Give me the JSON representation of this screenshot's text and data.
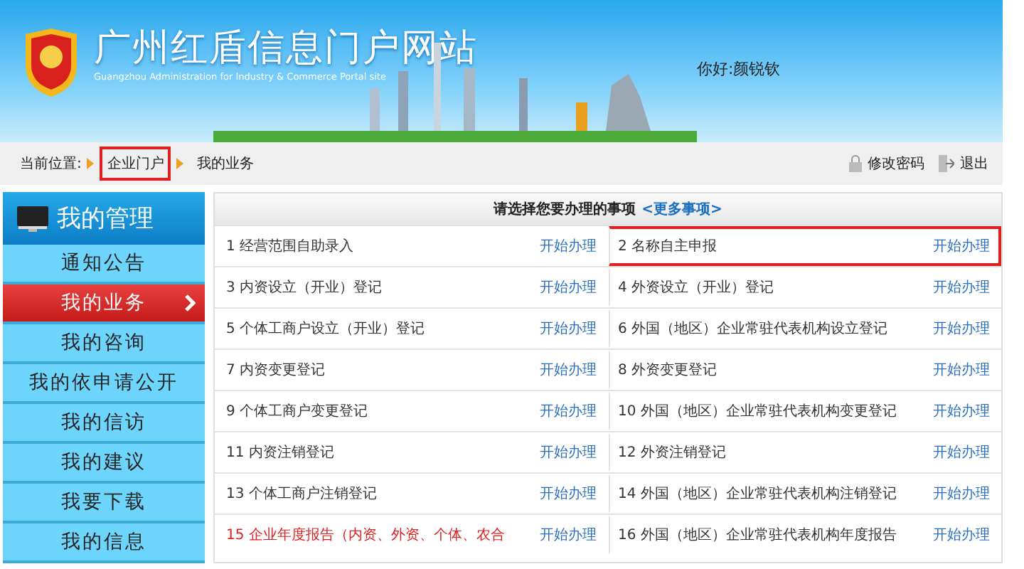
{
  "header": {
    "title": "广州红盾信息门户网站",
    "subtitle": "Guangzhou Administration for Industry & Commerce Portal site",
    "greeting": "你好:颜锐钦"
  },
  "breadcrumb": {
    "label": "当前位置:",
    "items": [
      {
        "text": "企业门户",
        "highlighted": true
      },
      {
        "text": "我的业务",
        "highlighted": false
      }
    ],
    "links": [
      {
        "kind": "lock",
        "text": "修改密码"
      },
      {
        "kind": "exit",
        "text": "退出"
      }
    ]
  },
  "sidebar": {
    "title": "我的管理",
    "items": [
      {
        "label": "通知公告",
        "selected": false
      },
      {
        "label": "我的业务",
        "selected": true
      },
      {
        "label": "我的咨询",
        "selected": false
      },
      {
        "label": "我的依申请公开",
        "selected": false
      },
      {
        "label": "我的信访",
        "selected": false
      },
      {
        "label": "我的建议",
        "selected": false
      },
      {
        "label": "我要下载",
        "selected": false
      },
      {
        "label": "我的信息",
        "selected": false
      }
    ]
  },
  "table": {
    "heading": "请选择您要办理的事项",
    "more_link": "<更多事项>",
    "rows": [
      [
        {
          "name": "1 经营范围自助录入",
          "action": "开始办理",
          "highlighted": false,
          "alert": false
        },
        {
          "name": "2 名称自主申报",
          "action": "开始办理",
          "highlighted": true,
          "alert": false
        }
      ],
      [
        {
          "name": "3 内资设立（开业）登记",
          "action": "开始办理",
          "highlighted": false,
          "alert": false
        },
        {
          "name": "4 外资设立（开业）登记",
          "action": "开始办理",
          "highlighted": false,
          "alert": false
        }
      ],
      [
        {
          "name": "5 个体工商户设立（开业）登记",
          "action": "开始办理",
          "highlighted": false,
          "alert": false
        },
        {
          "name": "6 外国（地区）企业常驻代表机构设立登记",
          "action": "开始办理",
          "highlighted": false,
          "alert": false
        }
      ],
      [
        {
          "name": "7 内资变更登记",
          "action": "开始办理",
          "highlighted": false,
          "alert": false
        },
        {
          "name": "8 外资变更登记",
          "action": "开始办理",
          "highlighted": false,
          "alert": false
        }
      ],
      [
        {
          "name": "9 个体工商户变更登记",
          "action": "开始办理",
          "highlighted": false,
          "alert": false
        },
        {
          "name": "10 外国（地区）企业常驻代表机构变更登记",
          "action": "开始办理",
          "highlighted": false,
          "alert": false
        }
      ],
      [
        {
          "name": "11 内资注销登记",
          "action": "开始办理",
          "highlighted": false,
          "alert": false
        },
        {
          "name": "12 外资注销登记",
          "action": "开始办理",
          "highlighted": false,
          "alert": false
        }
      ],
      [
        {
          "name": "13 个体工商户注销登记",
          "action": "开始办理",
          "highlighted": false,
          "alert": false
        },
        {
          "name": "14 外国（地区）企业常驻代表机构注销登记",
          "action": "开始办理",
          "highlighted": false,
          "alert": false
        }
      ],
      [
        {
          "name": "15 企业年度报告（内资、外资、个体、农合",
          "action": "开始办理",
          "highlighted": false,
          "alert": true
        },
        {
          "name": "16 外国（地区）企业常驻代表机构年度报告",
          "action": "开始办理",
          "highlighted": false,
          "alert": false
        }
      ]
    ]
  }
}
